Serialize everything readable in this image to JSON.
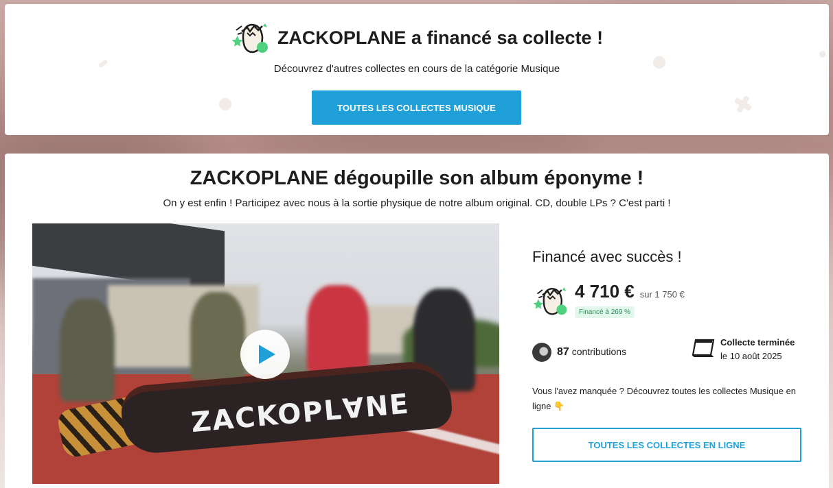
{
  "banner": {
    "title": "ZACKOPLANE a financé sa collecte !",
    "subtitle": "Découvrez d'autres collectes en cours de la catégorie Musique",
    "button_label": "TOUTES LES COLLECTES MUSIQUE"
  },
  "project": {
    "title": "ZACKOPLANE dégoupille son album éponyme !",
    "subtitle": "On y est enfin ! Participez avec nous à la sortie physique de notre album original. CD, double LPs ? C'est parti !",
    "video_logo_text": "ZACKOPL∀NE"
  },
  "funding": {
    "status": "Financé avec succès !",
    "amount": "4 710 €",
    "goal": "sur 1 750 €",
    "percent_badge": "Financé à 269 %",
    "contributions_count": "87",
    "contributions_label": "contributions",
    "ended_title": "Collecte terminée",
    "ended_date": "le 10 août 2025",
    "missed_text": "Vous l'avez manquée ? Découvrez toutes les collectes Musique en ligne 👇",
    "button_label": "TOUTES LES COLLECTES EN LIGNE"
  },
  "colors": {
    "accent": "#1fa0d8",
    "success": "#27925a",
    "success_bg": "#e4f7ec"
  },
  "icons": [
    "hatched-egg-icon",
    "play-icon",
    "avatar",
    "calendar-icon"
  ]
}
